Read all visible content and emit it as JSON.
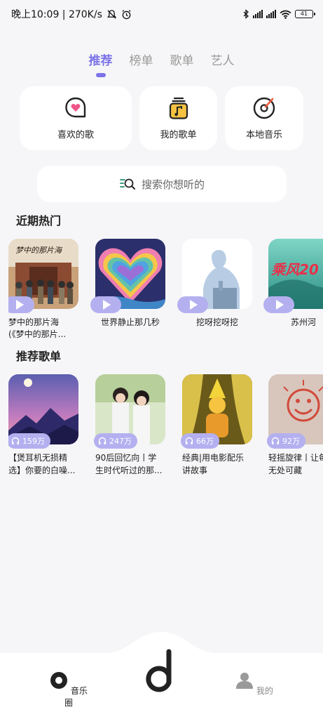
{
  "status": {
    "time": "晚上10:09 | 270K/s",
    "battery": "41"
  },
  "tabs": [
    {
      "label": "推荐",
      "active": true
    },
    {
      "label": "榜单",
      "active": false
    },
    {
      "label": "歌单",
      "active": false
    },
    {
      "label": "艺人",
      "active": false
    }
  ],
  "quick": [
    {
      "label": "喜欢的歌",
      "icon": "heart-chat-icon"
    },
    {
      "label": "我的歌单",
      "icon": "playlist-note-icon"
    },
    {
      "label": "本地音乐",
      "icon": "vinyl-disc-icon"
    }
  ],
  "search": {
    "placeholder": "搜索你想听的"
  },
  "sections": {
    "recent_hot": "近期热门",
    "recommend_playlists": "推荐歌单"
  },
  "recent": [
    {
      "title": "梦中的那片海(《梦中的那片...",
      "line1": "梦中的那片海",
      "line2": "(《梦中的那片...",
      "cover_text": "梦中的那片海"
    },
    {
      "title": "世界静止那几秒"
    },
    {
      "title": "挖呀挖呀挖"
    },
    {
      "title": "苏州河",
      "cover_text": "乘风20"
    }
  ],
  "playlists": [
    {
      "line1": "【煲耳机无损精",
      "line2": "选】你要的白噪...",
      "count": "159万"
    },
    {
      "line1": "90后回忆向丨学",
      "line2": "生时代听过的那...",
      "count": "247万"
    },
    {
      "line1": "经典|用电影配乐",
      "line2": "讲故事",
      "count": "66万"
    },
    {
      "line1": "轻摇旋律丨让每",
      "line2": "无处可藏",
      "count": "92万"
    }
  ],
  "bottom_nav": [
    {
      "label": "音乐圈",
      "icon": "music-circle-icon"
    },
    {
      "label": "我的",
      "icon": "user-icon"
    }
  ],
  "colors": {
    "accent": "#7b74e8",
    "badge": "#b4b0f0",
    "background": "#f6f6f8"
  }
}
